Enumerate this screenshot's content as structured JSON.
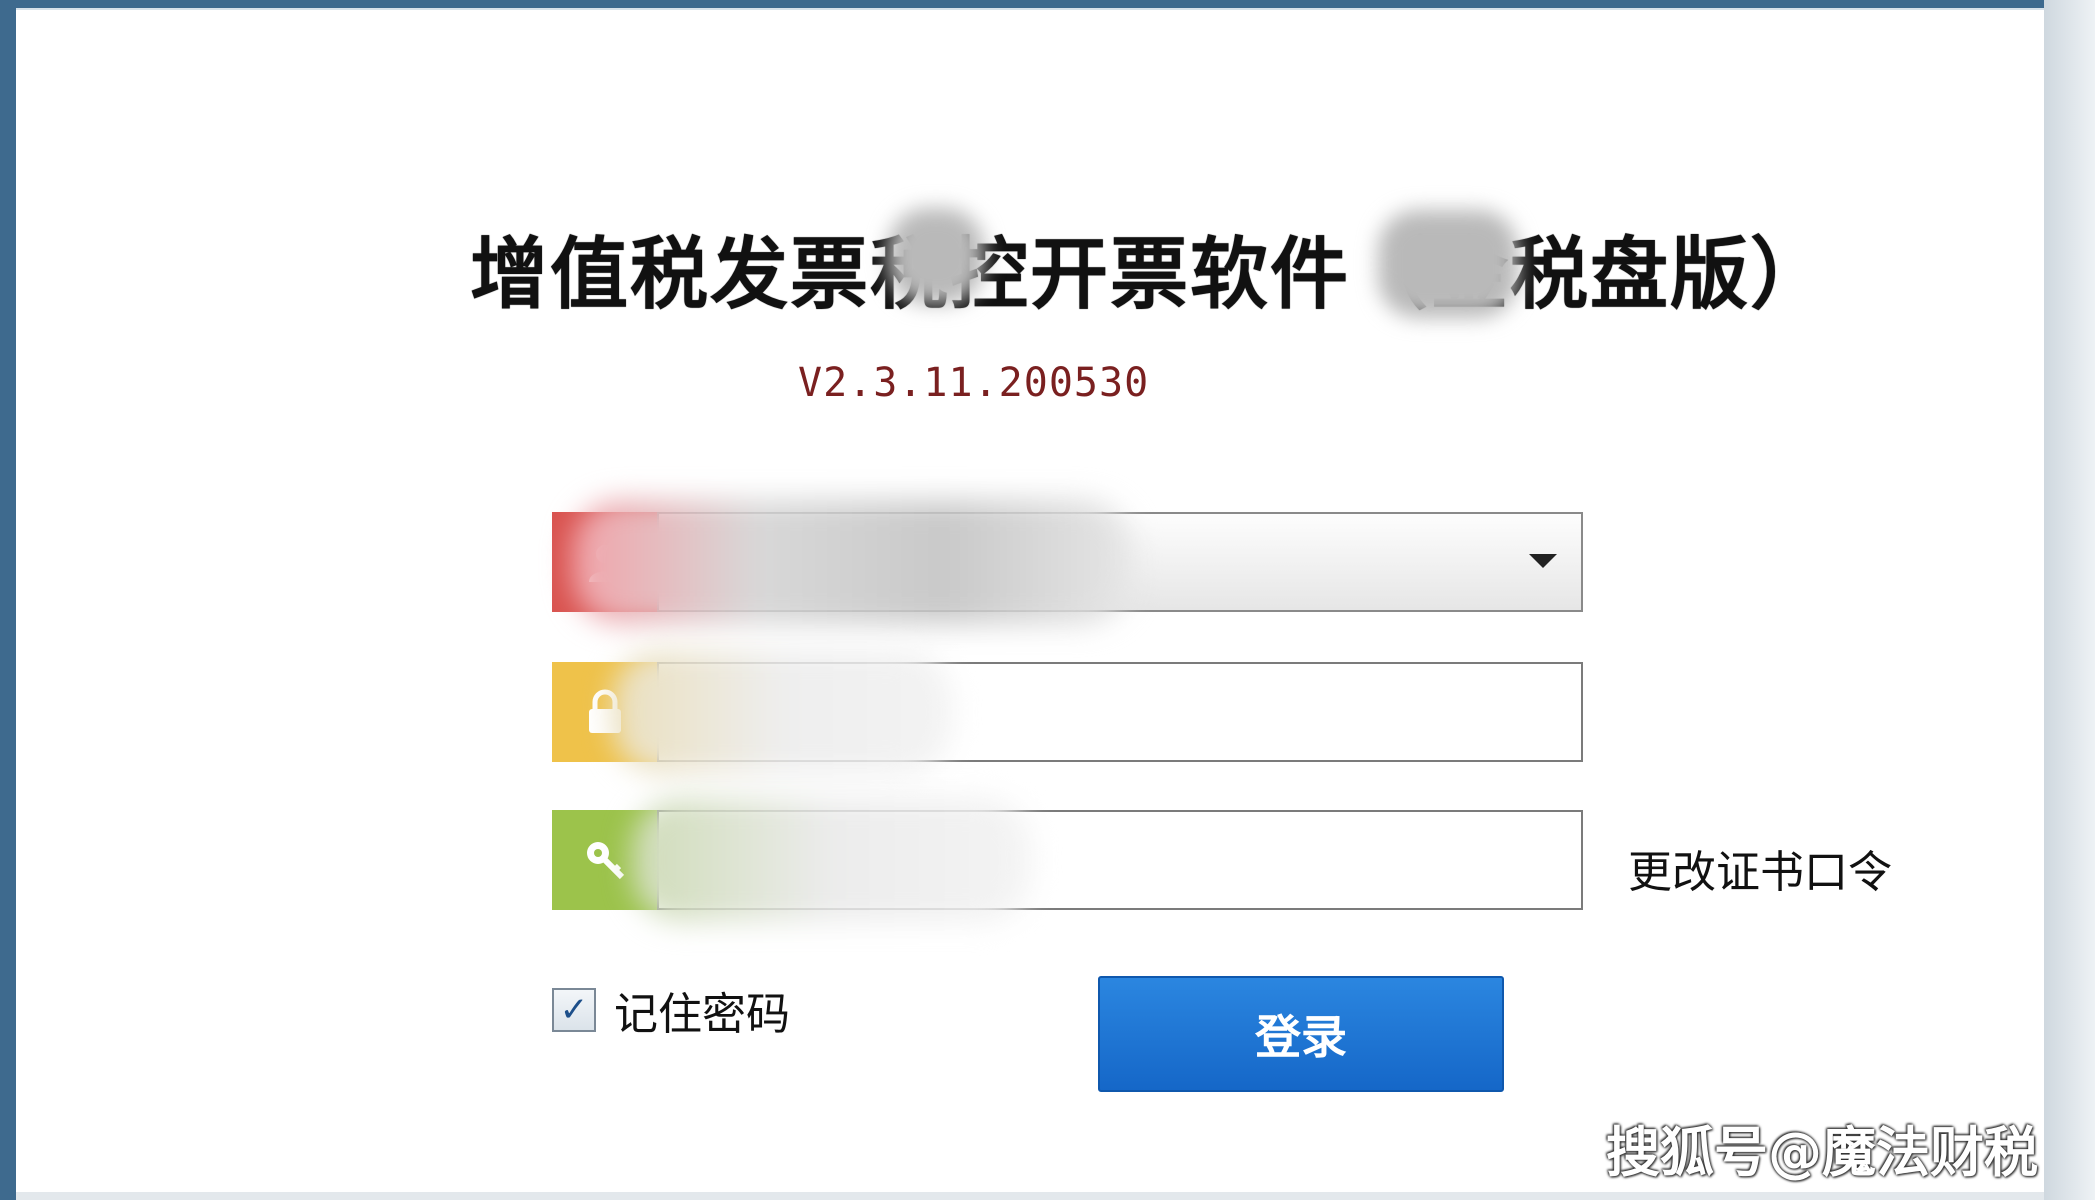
{
  "window": {
    "title": "增值税发票税控开票软件（金税盘版）",
    "version": "V2.3.11.200530"
  },
  "form": {
    "user_select_value": "",
    "password_placeholder": "",
    "cert_password_placeholder": "",
    "change_cert_label": "更改证书口令",
    "remember_label": "记住密码",
    "remember_checked_mark": "✓",
    "login_label": "登录"
  },
  "icons": {
    "user": "user-icon",
    "lock": "lock-icon",
    "key": "key-icon"
  },
  "colors": {
    "user_icon_bg": "#d9534f",
    "lock_icon_bg": "#efc24a",
    "key_icon_bg": "#9cc34b",
    "login_button": "#1a6fd0",
    "version_text": "#7a2020"
  },
  "watermark": "搜狐号@魔法财税"
}
